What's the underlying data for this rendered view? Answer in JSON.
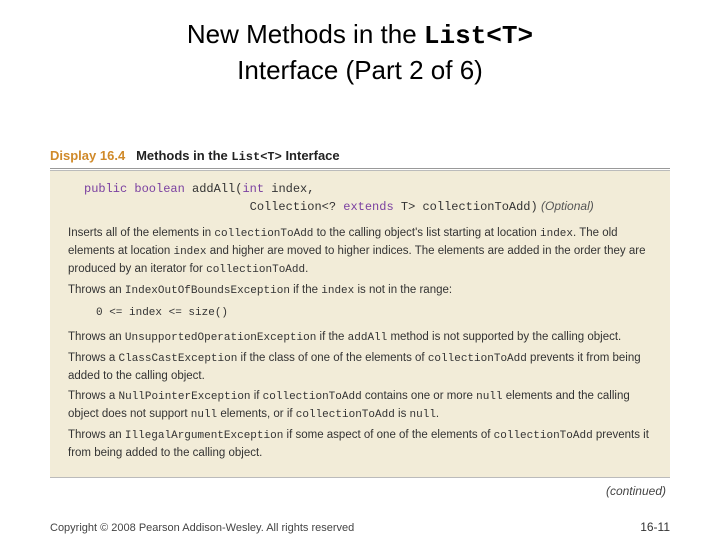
{
  "title": {
    "prefix": "New Methods in the ",
    "code": "List<T>",
    "suffix": " Interface (Part 2 of 6)"
  },
  "display": {
    "label": "Display",
    "number": "16.4",
    "caption_before": "Methods in the ",
    "caption_code": "List<T>",
    "caption_after": " Interface"
  },
  "signature": {
    "kw1": "public boolean",
    "name": " addAll(",
    "kw2": "int",
    "rest1": " index,",
    "line2_indent": "                       Collection<? ",
    "kw3": "extends",
    "rest2": " T> collectionToAdd)",
    "optional": " (Optional)"
  },
  "paras": {
    "p1a": "Inserts all of the elements in ",
    "p1code1": "collectionToAdd",
    "p1b": " to the calling object's list starting at location ",
    "p1code2": "index",
    "p1c": ". The old elements at location ",
    "p1code3": "index",
    "p1d": " and higher are moved to higher indices. The elements are added in the order they are produced by an iterator for ",
    "p1code4": "collectionToAdd",
    "p1e": ".",
    "p2a": "Throws an ",
    "p2code1": "IndexOutOfBoundsException",
    "p2b": " if the ",
    "p2code2": "index",
    "p2c": " is not in the range:",
    "codeblock": "0 <= index <= size()",
    "p3a": "Throws an ",
    "p3code1": "UnsupportedOperationException",
    "p3b": " if the ",
    "p3code2": "addAll",
    "p3c": " method is not supported by the calling object.",
    "p4a": "Throws a ",
    "p4code1": "ClassCastException",
    "p4b": " if the class of one of the elements of ",
    "p4code2": "collectionToAdd",
    "p4c": " prevents it from being added to the calling object.",
    "p5a": "Throws a ",
    "p5code1": "NullPointerException",
    "p5b": " if ",
    "p5code2": "collectionToAdd",
    "p5c": " contains one or more ",
    "p5code3": "null",
    "p5d": " elements and the calling object does not support ",
    "p5code4": "null",
    "p5e": " elements, or if ",
    "p5code5": "collectionToAdd",
    "p5f": " is ",
    "p5code6": "null",
    "p5g": ".",
    "p6a": "Throws an ",
    "p6code1": "IllegalArgumentException",
    "p6b": " if some aspect of one of the elements of ",
    "p6code2": "collectionToAdd",
    "p6c": " prevents it from being added to the calling object."
  },
  "continued": "(continued)",
  "footer": {
    "copyright": "Copyright © 2008 Pearson Addison-Wesley. All rights reserved",
    "pagenum": "16-11"
  }
}
